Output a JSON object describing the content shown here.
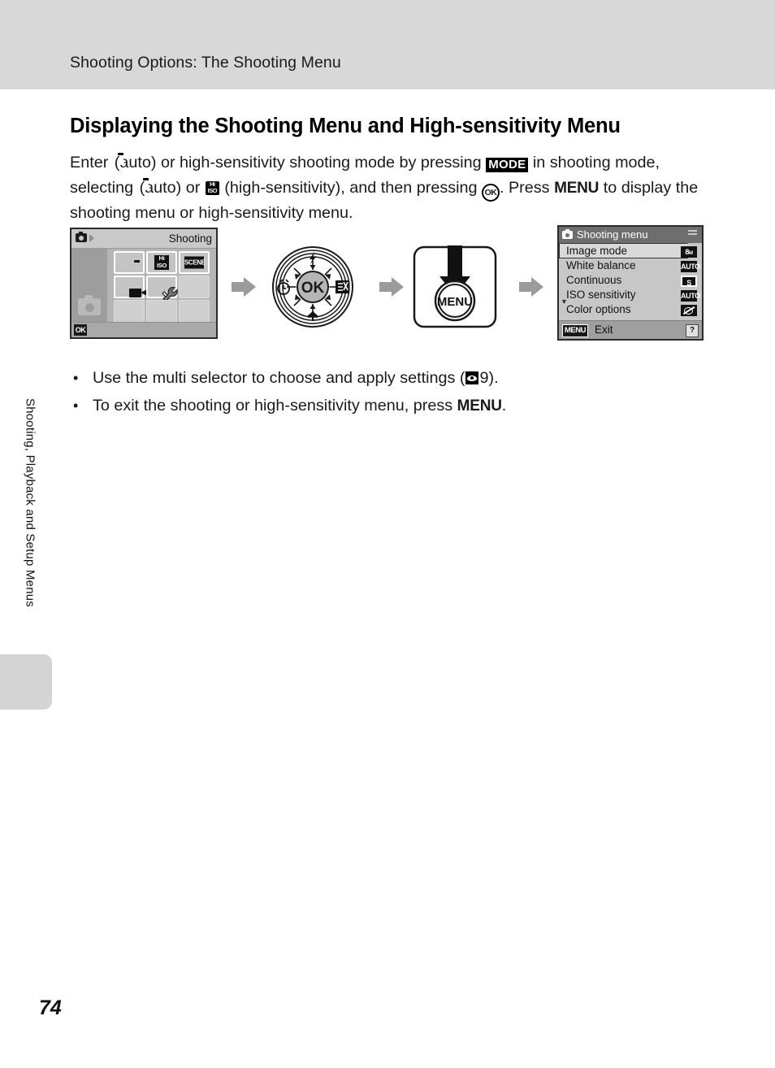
{
  "header": {
    "running_title": "Shooting Options: The Shooting Menu"
  },
  "section": {
    "heading": "Displaying the Shooting Menu and High-sensitivity Menu",
    "paragraph": {
      "p1": "Enter ",
      "p2": " (auto) or high-sensitivity shooting mode by pressing ",
      "p3": " in shooting mode, selecting ",
      "p4": " (auto) or ",
      "p5": " (high-sensitivity), and then pressing ",
      "p6": ". Press ",
      "p7": " to display the shooting menu or high-sensitivity menu.",
      "icon_camera": "camera-icon",
      "icon_hiso_hi": "Hi",
      "icon_hiso_iso": "ISO",
      "icon_mode": "MODE",
      "icon_ok": "OK",
      "icon_menu": "MENU"
    }
  },
  "illustration": {
    "mode_select_screen": {
      "title": "Shooting",
      "topbar_camera_icon": "camera-icon",
      "topbar_arrow_icon": "play-triangle-icon",
      "left_panel_camera_icon": "camera-large-icon",
      "ok_chip": "OK",
      "cells": [
        {
          "icon": "camera-icon",
          "filled": true,
          "label": ""
        },
        {
          "icon": "high-sensitivity-icon",
          "filled": true,
          "label_top": "Hi",
          "label_bottom": "ISO"
        },
        {
          "icon": "scene-icon",
          "filled": true,
          "label": "SCENE"
        },
        {
          "icon": "movie-icon",
          "filled": true,
          "label": ""
        },
        {
          "icon": "setup-wrench-icon",
          "filled": true,
          "label": ""
        },
        {
          "icon": "",
          "filled": false,
          "label": ""
        },
        {
          "icon": "",
          "filled": false,
          "label": ""
        },
        {
          "icon": "",
          "filled": false,
          "label": ""
        },
        {
          "icon": "",
          "filled": false,
          "label": ""
        }
      ]
    },
    "multi_selector": {
      "center_label": "OK",
      "top_icon": "flash-icon",
      "left_icon": "self-timer-icon",
      "right_icon": "exposure-compensation-icon",
      "bottom_icon": "macro-icon"
    },
    "menu_button": {
      "label": "MENU",
      "arrow_icon": "down-arrow-icon"
    },
    "shooting_menu_screen": {
      "title": "Shooting menu",
      "title_camera_icon": "camera-icon",
      "rows": [
        {
          "label": "Image mode",
          "icon": "8M",
          "icon_kind": "sub",
          "selected": true
        },
        {
          "label": "White balance",
          "icon": "AUTO",
          "icon_kind": "plain",
          "selected": false
        },
        {
          "label": "Continuous",
          "icon": "S",
          "icon_kind": "boxed",
          "selected": false
        },
        {
          "label": "ISO sensitivity",
          "icon": "AUTO",
          "icon_kind": "plain",
          "selected": false
        },
        {
          "label": "Color options",
          "icon": "",
          "icon_kind": "crossed",
          "selected": false
        }
      ],
      "scroll_down_indicator": "scroll-down-icon",
      "footer_menu_chip": "MENU",
      "footer_exit_label": "Exit",
      "footer_help": "?"
    },
    "arrows": [
      "flow-arrow-icon",
      "flow-arrow-icon",
      "flow-arrow-icon"
    ]
  },
  "bullets": [
    {
      "pre": "Use the multi selector to choose and apply settings (",
      "ref_icon": "see-reference-icon",
      "ref_page": "9",
      "post": ")."
    },
    {
      "pre": "To exit the shooting or high-sensitivity menu, press ",
      "menu_label": "MENU",
      "post": "."
    }
  ],
  "chapter_tab_label": "Shooting, Playback and Setup Menus",
  "page_number": "74"
}
